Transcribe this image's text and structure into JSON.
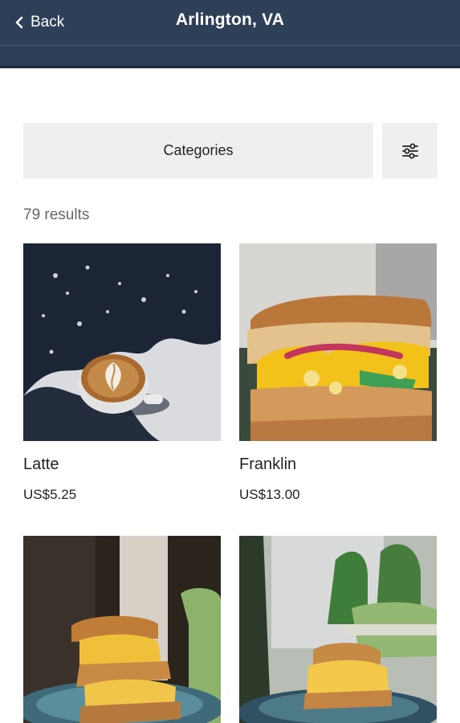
{
  "header": {
    "back_label": "Back",
    "title": "Arlington, VA"
  },
  "controls": {
    "categories_label": "Categories",
    "filter_icon": "sliders-icon"
  },
  "results_text": "79 results",
  "products": [
    {
      "name": "Latte",
      "price": "US$5.25",
      "image": "latte-art-cup-on-table"
    },
    {
      "name": "Franklin",
      "price": "US$13.00",
      "image": "egg-sandwich-on-focaccia"
    },
    {
      "name": "",
      "price": "",
      "image": "stacked-egg-sandwich-on-blue-plate"
    },
    {
      "name": "",
      "price": "",
      "image": "egg-sandwich-on-blue-plate-outdoor"
    }
  ],
  "colors": {
    "header_bg": "#2e4057",
    "button_bg": "#efefef",
    "muted_text": "#666666"
  }
}
